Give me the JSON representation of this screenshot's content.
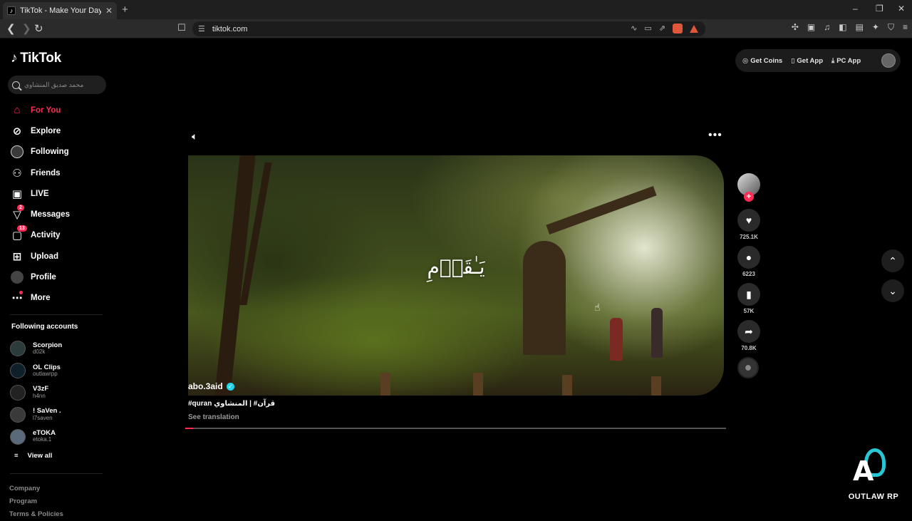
{
  "browser": {
    "tab_title": "TikTok - Make Your Day",
    "url": "tiktok.com",
    "favicon_glyph": "♪",
    "new_tab_glyph": "+",
    "close_glyph": "✕",
    "minimize_glyph": "–",
    "restore_glyph": "❐",
    "win_close_glyph": "✕"
  },
  "sidebar": {
    "logo_text": "TikTok",
    "search_placeholder": "محمد صديق المنشاوي",
    "nav": [
      {
        "label": "For You",
        "icon": "home-icon",
        "active": true
      },
      {
        "label": "Explore",
        "icon": "compass-icon"
      },
      {
        "label": "Following",
        "icon": "following-avatar-icon"
      },
      {
        "label": "Friends",
        "icon": "friends-icon"
      },
      {
        "label": "LIVE",
        "icon": "live-icon"
      },
      {
        "label": "Messages",
        "icon": "messages-icon",
        "badge": "2"
      },
      {
        "label": "Activity",
        "icon": "activity-icon",
        "badge": "13"
      },
      {
        "label": "Upload",
        "icon": "upload-icon"
      },
      {
        "label": "Profile",
        "icon": "profile-avatar-icon"
      },
      {
        "label": "More",
        "icon": "more-dots-icon"
      }
    ],
    "following_title": "Following accounts",
    "accounts": [
      {
        "name": "Scorpion",
        "handle": "d02k"
      },
      {
        "name": "OL Clips",
        "handle": "outlawrpp"
      },
      {
        "name": "V3zF",
        "handle": "h4nn"
      },
      {
        "name": "! SaVen .",
        "handle": "l7saven"
      },
      {
        "name": "eTOKA",
        "handle": "etoka.1"
      }
    ],
    "view_all": "View all",
    "footer": [
      "Company",
      "Program",
      "Terms & Policies"
    ]
  },
  "top_actions": {
    "coins": "Get Coins",
    "app": "Get App",
    "pc_app": "PC App"
  },
  "video": {
    "overlay_text": "يَـٰقَوۡمِ",
    "author": "abo.3aid",
    "description": "#quran قرآن# | المنشاوي",
    "see_translation": "See translation",
    "progress_fraction": 0.015
  },
  "actions": {
    "likes": "725.1K",
    "comments": "6223",
    "saves": "57K",
    "shares": "70.8K"
  },
  "watermark": {
    "text": "OUTLAW RP"
  },
  "colors": {
    "accent": "#fe2c55",
    "verified": "#20d5ec",
    "watermark_ring": "#29c7d6"
  }
}
